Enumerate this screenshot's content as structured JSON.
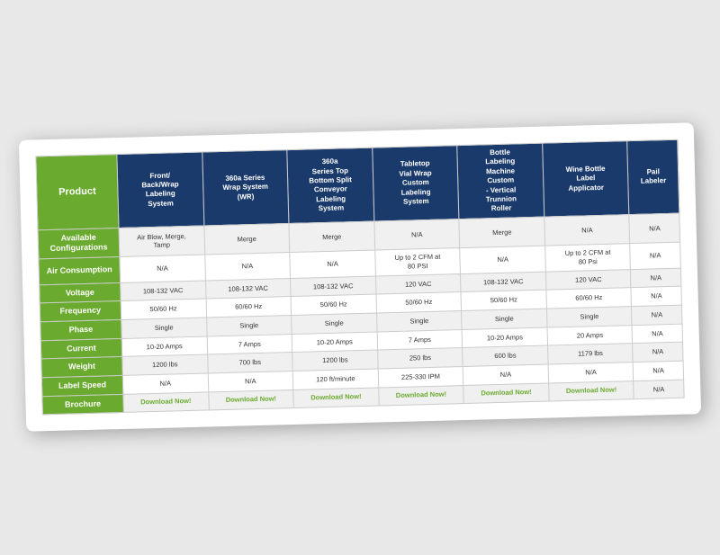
{
  "table": {
    "row_header_label": "Product",
    "columns": [
      {
        "id": "col1",
        "label": "Front/\nBack/Wrap\nLabeling\nSystem"
      },
      {
        "id": "col2",
        "label": "360a Series\nWrap System\n(WR)"
      },
      {
        "id": "col3",
        "label": "360a\nSeries Top\nBottom Split\nConveyor\nLabeling\nSystem"
      },
      {
        "id": "col4",
        "label": "Tabletop\nVial Wrap\nCustom\nLabeling\nSystem"
      },
      {
        "id": "col5",
        "label": "Bottle\nLabeling\nMachine\nCustom\n- Vertical\nTrunnion\nRoller"
      },
      {
        "id": "col6",
        "label": "Wine Bottle\nLabel\nApplicator"
      },
      {
        "id": "col7",
        "label": "Pail\nLabeler"
      }
    ],
    "rows": [
      {
        "header": "Available\nConfigurations",
        "cells": [
          "Air Blow, Merge, Tamp",
          "Merge",
          "",
          "N/A",
          "Merge",
          "N/A",
          "N/A"
        ]
      },
      {
        "header": "Air Consumption",
        "cells": [
          "N/A",
          "N/A",
          "N/A",
          "Up to 2 CFM at\n80 PSI",
          "N/A",
          "Up to 2 CFM at\n80 Psi",
          "N/A"
        ]
      },
      {
        "header": "Voltage",
        "cells": [
          "108-132 VAC",
          "108-132 VAC",
          "108-132 VAC",
          "120 VAC",
          "108-132 VAC",
          "120 VAC",
          "N/A"
        ]
      },
      {
        "header": "Frequency",
        "cells": [
          "50/60 Hz",
          "60/60 Hz",
          "50/60 Hz",
          "50/60 Hz",
          "50/60 Hz",
          "60/60 Hz",
          "N/A"
        ]
      },
      {
        "header": "Phase",
        "cells": [
          "Single",
          "Single",
          "Single",
          "Single",
          "Single",
          "Single",
          "N/A"
        ]
      },
      {
        "header": "Current",
        "cells": [
          "10-20 Amps",
          "7 Amps",
          "10-20 Amps",
          "7 Amps",
          "10-20 Amps",
          "20 Amps",
          "N/A"
        ]
      },
      {
        "header": "Weight",
        "cells": [
          "1200 lbs",
          "700 lbs",
          "1200 lbs",
          "250 lbs",
          "600 lbs",
          "1179 lbs",
          "N/A"
        ]
      },
      {
        "header": "Label Speed",
        "cells": [
          "N/A",
          "N/A",
          "120 ft/minute",
          "225-330 IPM",
          "N/A",
          "N/A",
          "N/A"
        ]
      },
      {
        "header": "Brochure",
        "cells": [
          "Download Now!",
          "Download Now!",
          "Download Now!",
          "Download Now!",
          "Download Now!",
          "Download Now!",
          "N/A"
        ],
        "is_brochure": true
      }
    ],
    "download_label": "Download Now!"
  }
}
